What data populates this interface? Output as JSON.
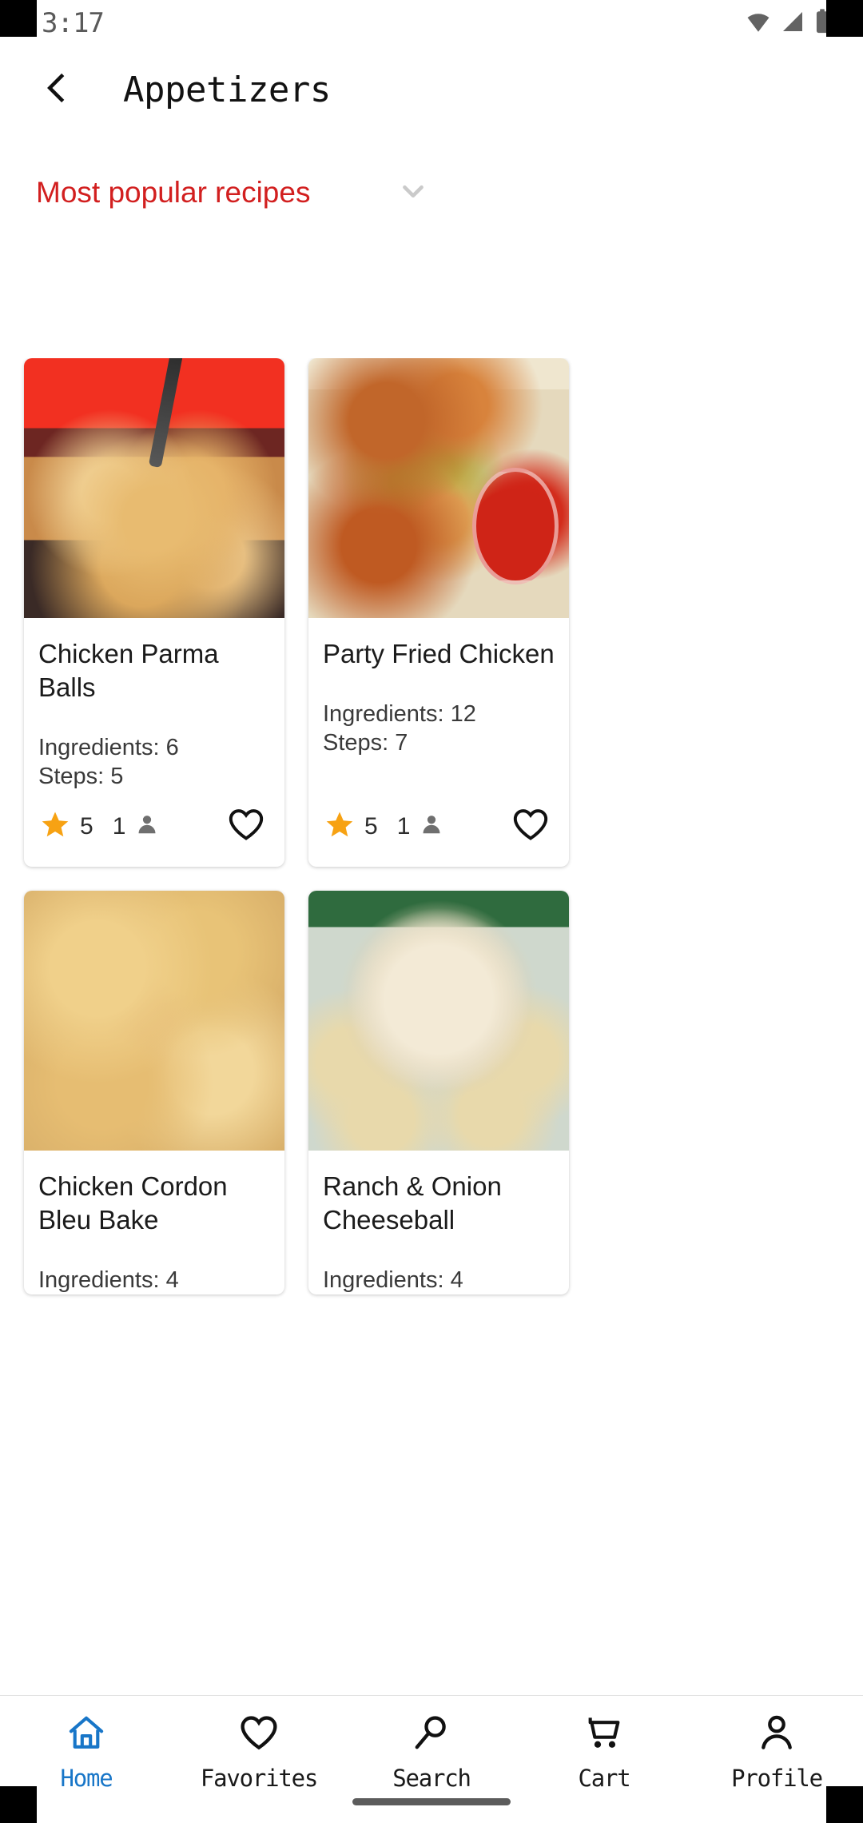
{
  "status_bar": {
    "time": "3:17",
    "icons": [
      "wifi-icon",
      "signal-icon",
      "battery-icon"
    ]
  },
  "app_bar": {
    "back_icon": "chevron-left-icon",
    "title": "Appetizers"
  },
  "filter": {
    "label": "Most popular recipes",
    "chevron_icon": "chevron-down-icon",
    "color": "#d21f1f"
  },
  "recipes": [
    {
      "title": "Chicken Parma Balls",
      "ingredients_label": "Ingredients: 6",
      "steps_label": "Steps: 5",
      "rating": "5",
      "reviews": "1",
      "photo": "chicken-parma-balls-photo",
      "favorite_icon": "heart-outline-icon"
    },
    {
      "title": "Party Fried Chicken",
      "ingredients_label": "Ingredients: 12",
      "steps_label": "Steps: 7",
      "rating": "5",
      "reviews": "1",
      "photo": "party-fried-chicken-photo",
      "favorite_icon": "heart-outline-icon"
    },
    {
      "title": "Chicken Cordon Bleu Bake",
      "ingredients_label": "Ingredients: 4",
      "steps_label": "",
      "rating": "",
      "reviews": "",
      "photo": "chicken-cordon-bleu-bake-photo",
      "favorite_icon": "heart-outline-icon"
    },
    {
      "title": "Ranch & Onion Cheeseball",
      "ingredients_label": "Ingredients: 4",
      "steps_label": "",
      "rating": "",
      "reviews": "",
      "photo": "ranch-onion-cheeseball-photo",
      "favorite_icon": "heart-outline-icon"
    }
  ],
  "bottom_nav": {
    "active_color": "#1876c8",
    "items": [
      {
        "label": "Home",
        "icon": "home-icon",
        "active": true
      },
      {
        "label": "Favorites",
        "icon": "heart-icon",
        "active": false
      },
      {
        "label": "Search",
        "icon": "search-icon",
        "active": false
      },
      {
        "label": "Cart",
        "icon": "cart-icon",
        "active": false
      },
      {
        "label": "Profile",
        "icon": "person-icon",
        "active": false
      }
    ]
  }
}
